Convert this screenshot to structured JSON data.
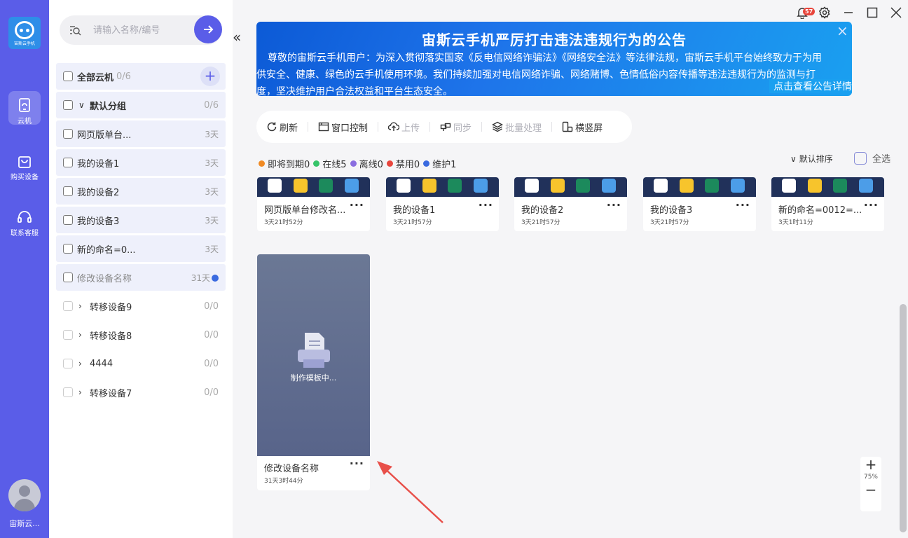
{
  "rail": {
    "logo_text": "宙斯云手机",
    "nav": [
      {
        "label": "云机",
        "icon": "cloud-phone-icon"
      },
      {
        "label": "购买设备",
        "icon": "shopping-bag-icon"
      },
      {
        "label": "联系客服",
        "icon": "headset-icon"
      }
    ],
    "user_name": "宙斯云..."
  },
  "sidebar": {
    "search_placeholder": "请输入名称/编号",
    "all": {
      "label": "全部云机",
      "count": "0/6"
    },
    "default_group": {
      "label": "默认分组",
      "count": "0/6"
    },
    "devices": [
      {
        "name": "网页版单台...",
        "days": "3天"
      },
      {
        "name": "我的设备1",
        "days": "3天"
      },
      {
        "name": "我的设备2",
        "days": "3天"
      },
      {
        "name": "我的设备3",
        "days": "3天"
      },
      {
        "name": "新的命名=0...",
        "days": "3天"
      },
      {
        "name": "修改设备名称",
        "days": "31天"
      }
    ],
    "groups": [
      {
        "label": "转移设备9",
        "count": "0/0"
      },
      {
        "label": "转移设备8",
        "count": "0/0"
      },
      {
        "label": "4444",
        "count": "0/0"
      },
      {
        "label": "转移设备7",
        "count": "0/0"
      }
    ]
  },
  "window": {
    "badge": "57"
  },
  "banner": {
    "title": "宙斯云手机严厉打击违法违规行为的公告",
    "line1": "尊敬的宙斯云手机用户：为深入贯彻落实国家《反电信网络诈骗法》《网络安全法》等法律法规，宙斯云手机平台始终致力于为用",
    "line2": "提供安全、健康、绿色的云手机使用环境。我们持续加强对电信网络诈骗、网络赌博、色情低俗内容传播等违法违规行为的监测与打",
    "line3": "力度，坚决维护用户合法权益和平台生态安全。",
    "more": "点击查看公告详情"
  },
  "toolbar": {
    "refresh": "刷新",
    "window_control": "窗口控制",
    "upload": "上传",
    "sync": "同步",
    "batch": "批量处理",
    "orientation": "横竖屏"
  },
  "stats": {
    "expiring": "即将到期0",
    "online": "在线5",
    "offline": "离线0",
    "disabled": "禁用0",
    "maintenance": "维护1"
  },
  "sort": {
    "label": "默认排序",
    "select_all": "全选"
  },
  "colors": {
    "accent": "#5a5de8",
    "expiring": "#f08a24",
    "online": "#36c46a",
    "offline": "#8a6ee0",
    "disabled": "#e8453c",
    "maintenance": "#3a6ae0"
  },
  "cards": [
    {
      "name": "网页版单台修改名...",
      "time": "3天21时52分"
    },
    {
      "name": "我的设备1",
      "time": "3天21时57分"
    },
    {
      "name": "我的设备2",
      "time": "3天21时57分"
    },
    {
      "name": "我的设备3",
      "time": "3天21时57分"
    },
    {
      "name": "新的命名=0012=...",
      "time": "3天1时11分"
    }
  ],
  "big_card": {
    "status": "制作模板中...",
    "name": "修改设备名称",
    "time": "31天3时44分"
  },
  "zoom": {
    "value": "75%"
  }
}
